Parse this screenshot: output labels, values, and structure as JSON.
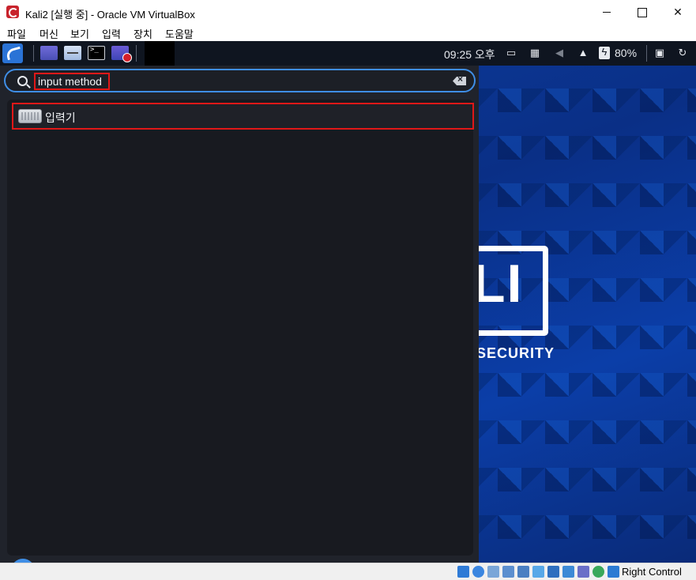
{
  "window": {
    "title": "Kali2 [실행 중] - Oracle VM VirtualBox",
    "menu": [
      "파일",
      "머신",
      "보기",
      "입력",
      "장치",
      "도움말"
    ]
  },
  "panel": {
    "clock": "09:25 오후",
    "battery": "80%"
  },
  "search": {
    "value": "input method",
    "placeholder": ""
  },
  "results": [
    {
      "label": "입력기",
      "icon": "keyboard-icon"
    }
  ],
  "wallpaper": {
    "logo_text": "LI",
    "tagline": "SECURITY"
  },
  "statusbar": {
    "host_key": "Right Control"
  },
  "colors": {
    "accent": "#3f8ee6",
    "highlight": "#e01818",
    "menu_bg": "#20232b",
    "panel_bg": "#0f1520"
  }
}
